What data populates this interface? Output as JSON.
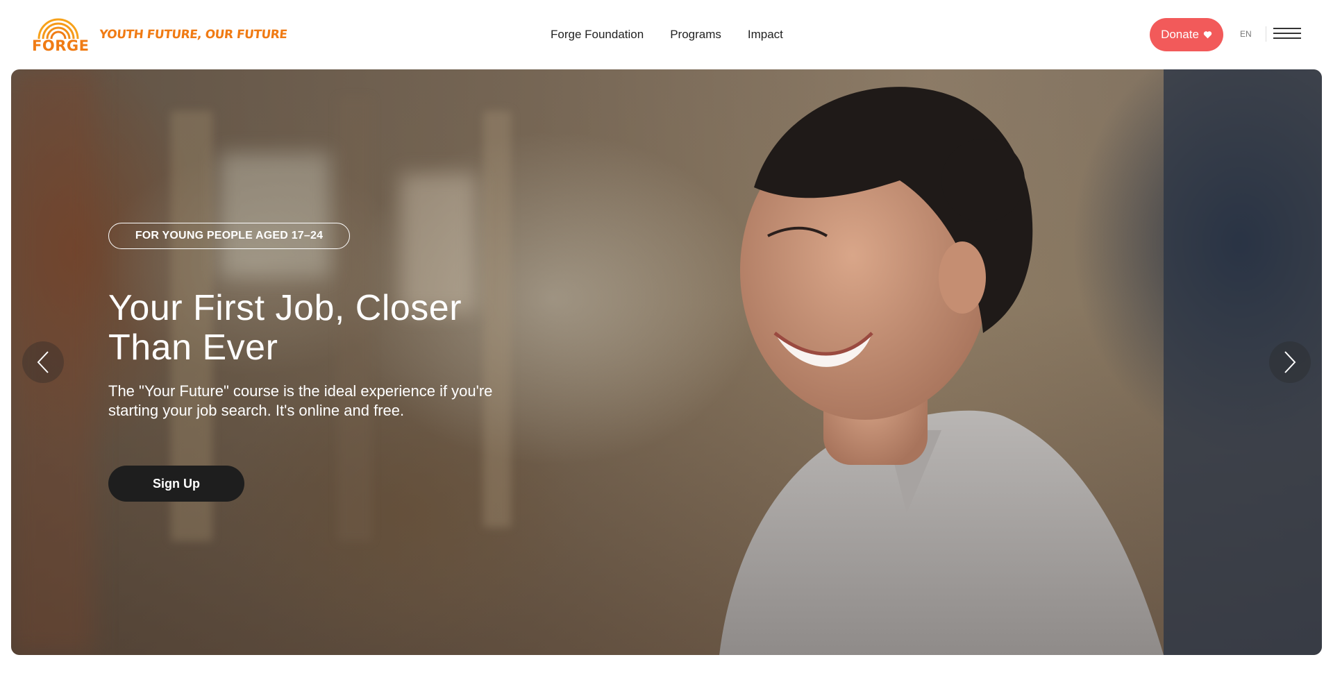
{
  "header": {
    "logo": {
      "wordmark": "FORGE",
      "icon": "rainbow-arc-icon"
    },
    "tagline": "YOUTH FUTURE, OUR FUTURE",
    "nav": [
      "Forge Foundation",
      "Programs",
      "Impact"
    ],
    "donate": {
      "label": "Donate",
      "icon": "heart-icon"
    },
    "language": "EN",
    "menu_icon": "hamburger-menu-icon"
  },
  "hero": {
    "tag": "FOR YOUNG PEOPLE AGED 17–24",
    "title": "Your First Job, Closer Than Ever",
    "description": "The \"Your Future\" course is the ideal experience if you're starting your job search. It's online and free.",
    "cta": "Sign Up",
    "prev_icon": "chevron-left-icon",
    "next_icon": "chevron-right-icon"
  },
  "colors": {
    "brand_orange": "#f07b14",
    "donate_red": "#f25a5a",
    "cta_dark": "#1e1e1e"
  }
}
